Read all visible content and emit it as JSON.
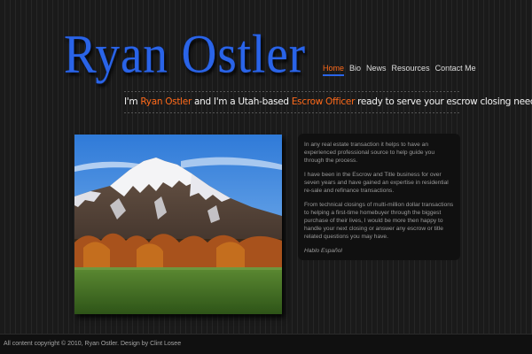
{
  "header": {
    "logo_text": "Ryan Ostler"
  },
  "nav": {
    "items": [
      {
        "label": "Home",
        "active": true
      },
      {
        "label": "Bio",
        "active": false
      },
      {
        "label": "News",
        "active": false
      },
      {
        "label": "Resources",
        "active": false
      },
      {
        "label": "Contact Me",
        "active": false
      }
    ]
  },
  "tagline": {
    "part1": "I'm ",
    "name": "Ryan Ostler",
    "part2": " and I'm a Utah-based ",
    "role": "Escrow Officer",
    "part3": " ready to serve your escrow closing needs."
  },
  "photo": {
    "subject": "snow-capped mountain landscape with autumn trees and green field"
  },
  "info": {
    "paragraphs": [
      "In any real estate transaction it helps to have an experienced professional source to help guide you through the process.",
      "I have been in the Escrow and Title business for over seven years and have gained an expertise in residential re-sale and refinance transactions.",
      "From technical closings of multi-million dollar transactions to helping a first-time homebuyer through the biggest purchase of their lives, I would be more then happy to handle your next closing or answer any escrow or title related questions you may have."
    ],
    "spanish": "Hablo Español"
  },
  "footer": {
    "text": "All content copyright © 2010, Ryan Ostler. Design by Clint Losee"
  },
  "colors": {
    "logo_blue": "#2a64e8",
    "accent_orange": "#ff6a1a",
    "background": "#1c1c1c"
  }
}
